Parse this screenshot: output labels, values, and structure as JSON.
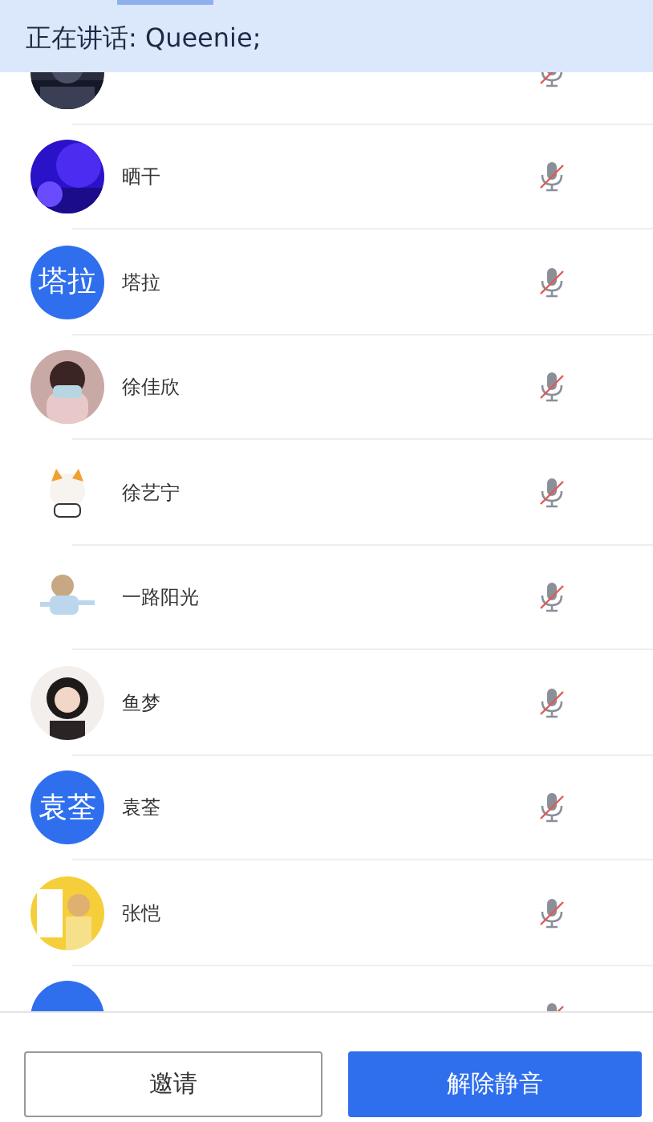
{
  "speaking_banner": {
    "text": "正在讲话: Queenie;"
  },
  "participants": [
    {
      "muted": true
    },
    {
      "name": "晒干",
      "muted": true
    },
    {
      "name": "塔拉",
      "avatar": {
        "kind": "text",
        "text": "塔拉"
      },
      "muted": true
    },
    {
      "name": "徐佳欣",
      "muted": true
    },
    {
      "name": "徐艺宁",
      "muted": true
    },
    {
      "name": "一路阳光",
      "muted": true
    },
    {
      "name": "鱼梦",
      "muted": true
    },
    {
      "name": "袁荃",
      "avatar": {
        "kind": "text",
        "text": "袁荃"
      },
      "muted": true
    },
    {
      "name": "张恺",
      "muted": true
    },
    {
      "avatar": {
        "kind": "text"
      },
      "muted": true
    }
  ],
  "buttons": [
    {
      "label": "邀请",
      "kind": "outline"
    },
    {
      "label": "解除静音",
      "kind": "primary"
    }
  ]
}
